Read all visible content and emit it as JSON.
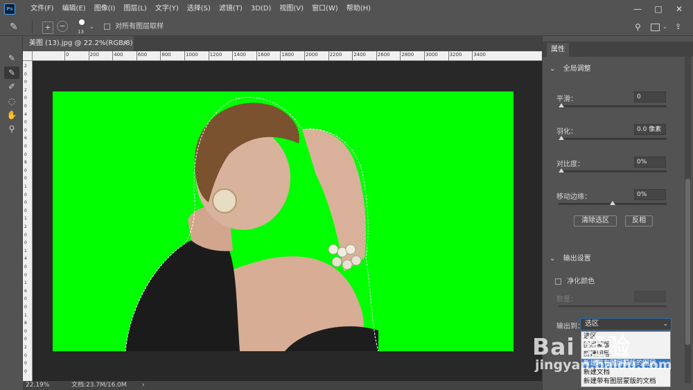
{
  "app": {
    "logo_text": "Ps"
  },
  "menu": [
    "文件(F)",
    "编辑(E)",
    "图像(I)",
    "图层(L)",
    "文字(Y)",
    "选择(S)",
    "滤镜(T)",
    "3D(D)",
    "视图(V)",
    "窗口(W)",
    "帮助(H)"
  ],
  "window_controls": {
    "minimize": "—",
    "maximize": "□",
    "close": "✕"
  },
  "options_bar": {
    "brush_size": "13",
    "sample_all_layers_label": "对所有图层取样",
    "sample_all_layers_checked": false
  },
  "toolbar": {
    "tools": [
      {
        "name": "quick-selection-tool-icon",
        "glyph": "✎",
        "active": false
      },
      {
        "name": "refine-edge-brush-icon",
        "glyph": "✎",
        "active": true
      },
      {
        "name": "brush-tool-icon",
        "glyph": "✐",
        "active": false
      },
      {
        "name": "lasso-tool-icon",
        "glyph": "◌",
        "active": false
      },
      {
        "name": "hand-tool-icon",
        "glyph": "✋",
        "active": false
      },
      {
        "name": "zoom-tool-icon",
        "glyph": "⚲",
        "active": false
      }
    ]
  },
  "document": {
    "tab_title": "美图 (13).jpg @ 22.2%(RGB/8)",
    "tab_close": "×",
    "ruler_h_labels": [
      "0",
      "200",
      "400",
      "600",
      "800",
      "1000",
      "1200",
      "1400",
      "1600",
      "1800",
      "2000",
      "2200",
      "2400",
      "2600",
      "2800",
      "3000",
      "3200",
      "3400"
    ],
    "ruler_v_labels": [
      "2",
      "0",
      "0",
      "2",
      "0",
      "0",
      "4",
      "0",
      "0",
      "6",
      "0",
      "0",
      "8",
      "0",
      "0",
      "1",
      "0",
      "0",
      "0",
      "1",
      "2",
      "0",
      "0",
      "1",
      "4",
      "0",
      "0",
      "1",
      "6",
      "0",
      "0",
      "1",
      "8",
      "0",
      "0",
      "2",
      "0",
      "0",
      "0"
    ],
    "canvas_color": "#00ff00"
  },
  "status_bar": {
    "zoom": "22.19%",
    "doc_info": "文档:23.7M/16.0M",
    "arrow": "›"
  },
  "properties_panel": {
    "tab": "属性",
    "global_section": "全局调整",
    "smooth": {
      "label": "平滑：",
      "value": "0",
      "position": 0.0
    },
    "feather": {
      "label": "羽化：",
      "value": "0.0 像素",
      "position": 0.0
    },
    "contrast": {
      "label": "对比度：",
      "value": "0%",
      "position": 0.0
    },
    "shift_edge": {
      "label": "移动边缘：",
      "value": "0%",
      "position": 0.5
    },
    "clear_selection_button": "清除选区",
    "invert_button": "反相",
    "output_section": "输出设置",
    "decontaminate_label": "净化颜色",
    "amount_label": "数量：",
    "output_to_label": "输出到：",
    "output_to_value": "选区",
    "output_options": [
      "选区",
      "图层蒙版",
      "新建图层",
      "新建带有图层蒙版的图层",
      "新建文档",
      "新建带有图层蒙版的文档"
    ],
    "output_selected_index": 3
  },
  "watermark": {
    "main": "Bai 经验",
    "sub": "jingyan.baidu.com"
  }
}
